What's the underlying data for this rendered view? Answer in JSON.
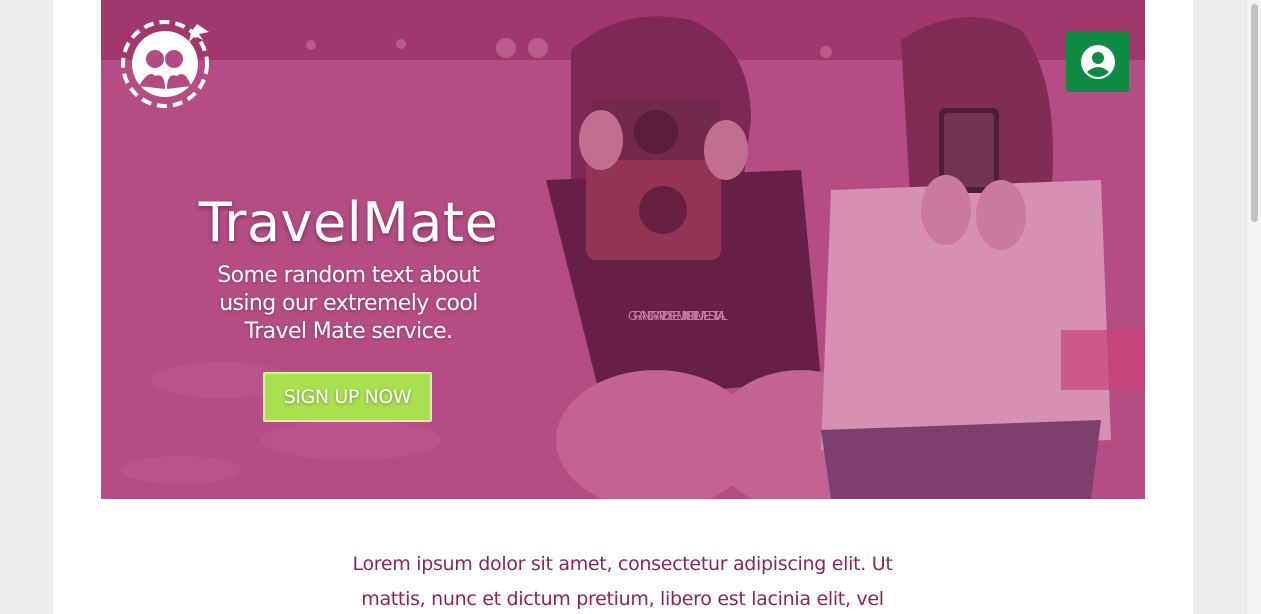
{
  "colors": {
    "hero_tint": "#b4447f",
    "account_button": "#0d8a44",
    "signup_button": "#a8e04e",
    "intro_text": "#8c2459"
  },
  "header": {
    "logo_icon": "travel-mates-globe-logo",
    "account_icon": "user-circle-icon"
  },
  "hero": {
    "title": "TravelMate",
    "subtitle": "Some random text about using our extremely cool Travel Mate service.",
    "cta_label": "SIGN UP NOW",
    "shirt_text": "GRAND RAPIDS FEMINIST FILM FESTIVAL"
  },
  "intro": {
    "text": "Lorem ipsum dolor sit amet, consectetur adipiscing elit. Ut mattis, nunc et dictum pretium, libero est lacinia elit, vel"
  }
}
